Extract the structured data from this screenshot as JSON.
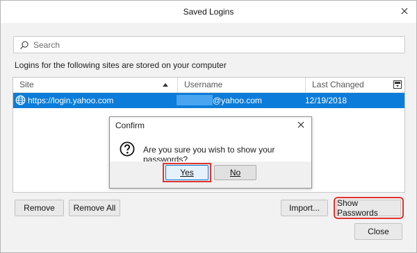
{
  "window": {
    "title": "Saved Logins"
  },
  "search": {
    "placeholder": "Search",
    "value": ""
  },
  "info_text": "Logins for the following sites are stored on your computer",
  "table": {
    "columns": [
      "Site",
      "Username",
      "Last Changed"
    ],
    "sort_column": "Site",
    "sort_direction": "ascending",
    "rows": [
      {
        "site": "https://login.yahoo.com",
        "username_suffix": "@yahoo.com",
        "last_changed": "12/19/2018",
        "selected": true
      }
    ]
  },
  "buttons": {
    "remove": "Remove",
    "remove_all": "Remove All",
    "import": "Import...",
    "show_passwords": "Show Passwords",
    "close": "Close"
  },
  "confirm_dialog": {
    "title": "Confirm",
    "message": "Are you sure you wish to show your passwords?",
    "yes": "Yes",
    "no": "No"
  },
  "colors": {
    "selection": "#0b7cd9",
    "highlight_annotation": "#e1332b",
    "default_button_border": "#0078d7"
  },
  "icons": {
    "close": "close-icon",
    "search": "search-icon",
    "sort": "sort-ascending-icon",
    "column_picker": "column-picker-icon",
    "globe": "globe-icon",
    "question": "question-icon"
  }
}
